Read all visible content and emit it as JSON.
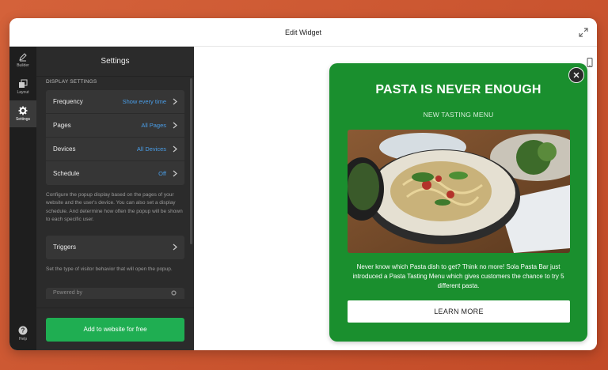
{
  "window": {
    "title": "Edit Widget"
  },
  "rail": {
    "items": [
      {
        "label": "Builder",
        "icon": "pen-icon"
      },
      {
        "label": "Layout",
        "icon": "layout-icon"
      },
      {
        "label": "Settings",
        "icon": "gear-icon",
        "active": true
      }
    ],
    "help": {
      "label": "Help",
      "icon": "help-icon"
    }
  },
  "panel": {
    "title": "Settings",
    "section": "DISPLAY SETTINGS",
    "rows": [
      {
        "label": "Frequency",
        "value": "Show every time"
      },
      {
        "label": "Pages",
        "value": "All Pages"
      },
      {
        "label": "Devices",
        "value": "All Devices"
      },
      {
        "label": "Schedule",
        "value": "Off"
      }
    ],
    "display_desc": "Configure the popup display based on the pages of your website and the user's device. You can also set a display schedule. And determine how often the popup will be shown to each specific user.",
    "triggers": {
      "label": "Triggers"
    },
    "triggers_desc": "Set the type of visitor behavior that will open the popup.",
    "partial_label": "Powered by",
    "cta": "Add to website for free"
  },
  "popup": {
    "title": "PASTA IS NEVER ENOUGH",
    "subtitle": "NEW TASTING MENU",
    "body": "Never know which Pasta dish to get? Think no more! Sola Pasta Bar just introduced a Pasta Tasting Menu which gives customers the chance to try 5 different pasta.",
    "button": "LEARN MORE",
    "bg_color": "#1a8f2e"
  },
  "colors": {
    "accent": "#4a9ee8",
    "cta": "#1fae52"
  }
}
